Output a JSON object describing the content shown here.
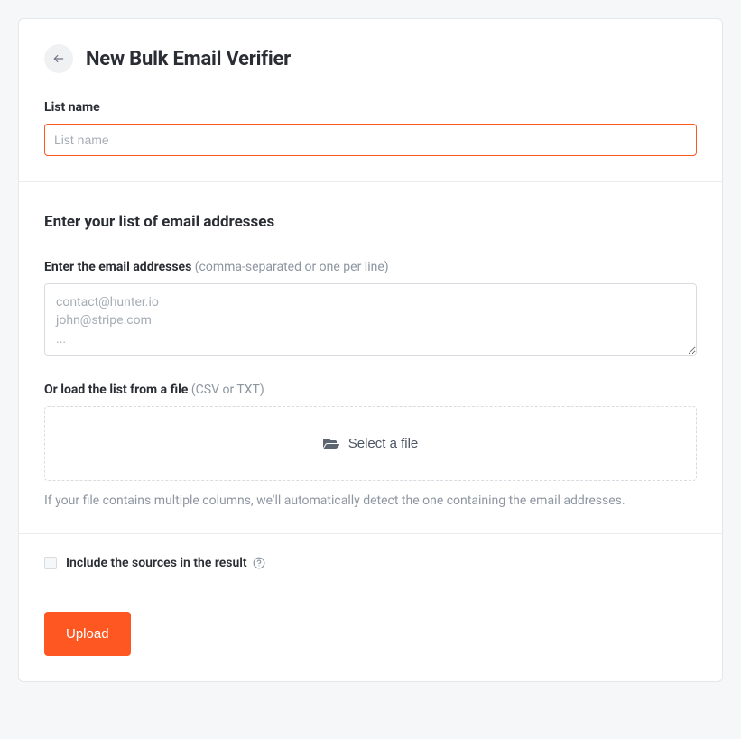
{
  "header": {
    "title": "New Bulk Email Verifier"
  },
  "list_name": {
    "label": "List name",
    "placeholder": "List name",
    "value": ""
  },
  "email_section": {
    "title": "Enter your list of email addresses",
    "textarea_label": "Enter the email addresses",
    "textarea_hint": "(comma-separated or one per line)",
    "textarea_placeholder": "contact@hunter.io\njohn@stripe.com\n...",
    "textarea_value": "",
    "file_label": "Or load the list from a file",
    "file_hint": "(CSV or TXT)",
    "file_button": "Select a file",
    "file_help": "If your file contains multiple columns, we'll automatically detect the one containing the email addresses."
  },
  "options": {
    "include_sources_label": "Include the sources in the result"
  },
  "footer": {
    "upload_label": "Upload"
  }
}
